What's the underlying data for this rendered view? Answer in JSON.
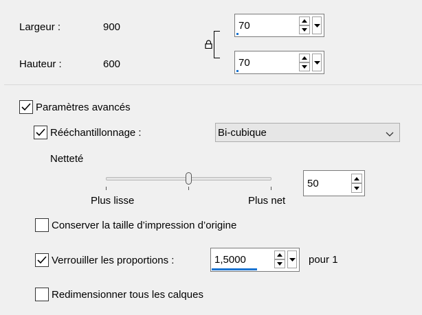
{
  "dimensions": {
    "width_label": "Largeur :",
    "width_value": "900",
    "height_label": "Hauteur :",
    "height_value": "600",
    "width_percent": "70",
    "height_percent": "70"
  },
  "advanced": {
    "label": "Paramètres avancés",
    "checked": true
  },
  "resampling": {
    "label": "Rééchantillonnage :",
    "checked": true,
    "method": "Bi-cubique"
  },
  "sharpness": {
    "label": "Netteté",
    "value": "50",
    "slider_level": 0.5,
    "min_label": "Plus lisse",
    "max_label": "Plus net"
  },
  "keep_print_size": {
    "label": "Conserver la taille d’impression d’origine",
    "checked": false
  },
  "lock_ratio": {
    "label": "Verrouiller les proportions :",
    "checked": true,
    "value": "1,5000",
    "suffix": "pour 1"
  },
  "resize_all_layers": {
    "label": "Redimensionner tous les calques",
    "checked": false
  },
  "colors": {
    "accent": "#1a73d1",
    "background": "#f0f0f0"
  }
}
